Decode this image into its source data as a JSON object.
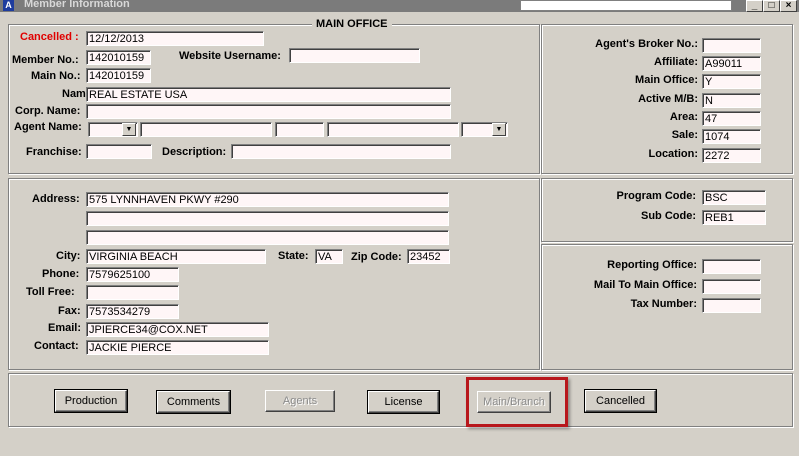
{
  "window": {
    "title": "Member Information"
  },
  "section_title": "MAIN OFFICE",
  "member": {
    "cancelled_label": "Cancelled :",
    "cancelled_value": "12/12/2013",
    "member_no_label": "Member No.:",
    "member_no_value": "142010159",
    "website_username_label": "Website Username:",
    "website_username_value": "",
    "main_no_label": "Main No.:",
    "main_no_value": "142010159",
    "name_label": "Name:",
    "name_value": "REAL ESTATE USA",
    "corp_name_label": "Corp. Name:",
    "corp_name_value": "",
    "agent_name_label": "Agent Name:",
    "franchise_label": "Franchise:",
    "franchise_value": "",
    "description_label": "Description:",
    "description_value": ""
  },
  "right_top": {
    "agents_broker_no_label": "Agent's Broker No.:",
    "agents_broker_no_value": "",
    "affiliate_label": "Affiliate:",
    "affiliate_value": "A99011",
    "main_office_label": "Main Office:",
    "main_office_value": "Y",
    "active_mb_label": "Active M/B:",
    "active_mb_value": "N",
    "area_label": "Area:",
    "area_value": "47",
    "sale_label": "Sale:",
    "sale_value": "1074",
    "location_label": "Location:",
    "location_value": "2272"
  },
  "address": {
    "address_label": "Address:",
    "address_line1": "575 LYNNHAVEN PKWY #290",
    "address_line2": "",
    "address_line3": "",
    "city_label": "City:",
    "city_value": "VIRGINIA BEACH",
    "state_label": "State:",
    "state_value": "VA",
    "zip_label": "Zip Code:",
    "zip_value": "23452",
    "phone_label": "Phone:",
    "phone_value": "7579625100",
    "toll_free_label": "Toll Free:",
    "toll_free_value": "",
    "fax_label": "Fax:",
    "fax_value": "7573534279",
    "email_label": "Email:",
    "email_value": "JPIERCE34@COX.NET",
    "contact_label": "Contact:",
    "contact_value": "JACKIE PIERCE"
  },
  "program": {
    "program_code_label": "Program Code:",
    "program_code_value": "BSC",
    "sub_code_label": "Sub Code:",
    "sub_code_value": "REB1"
  },
  "reporting": {
    "reporting_office_label": "Reporting Office:",
    "reporting_office_value": "",
    "mail_to_main_label": "Mail To Main Office:",
    "mail_to_main_value": "",
    "tax_number_label": "Tax Number:",
    "tax_number_value": ""
  },
  "buttons": {
    "production": "Production",
    "comments": "Comments",
    "agents": "Agents",
    "license": "License",
    "main_branch": "Main/Branch",
    "cancelled": "Cancelled"
  },
  "colors": {
    "highlight": "#b8171c",
    "cancelled_label": "#e00000"
  }
}
